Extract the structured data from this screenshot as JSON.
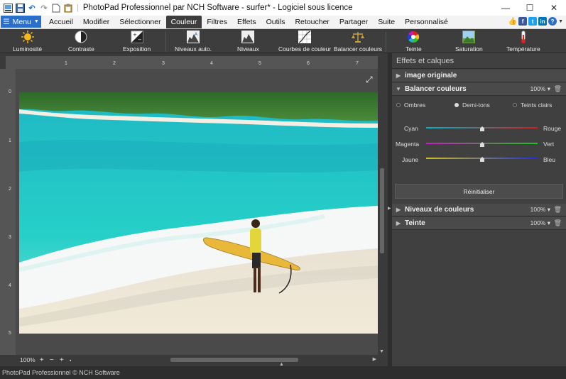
{
  "window": {
    "title": "PhotoPad Professionnel par NCH Software - surfer* - Logiciel sous licence",
    "controls": {
      "minimize": "—",
      "maximize": "☐",
      "close": "✕"
    }
  },
  "quick_access": [
    "app-icon",
    "save-icon",
    "undo-icon",
    "redo-icon",
    "new-icon",
    "paste-icon"
  ],
  "menu_button": "Menu",
  "tabs": [
    {
      "label": "Accueil",
      "active": false
    },
    {
      "label": "Modifier",
      "active": false
    },
    {
      "label": "Sélectionner",
      "active": false
    },
    {
      "label": "Couleur",
      "active": true
    },
    {
      "label": "Filtres",
      "active": false
    },
    {
      "label": "Effets",
      "active": false
    },
    {
      "label": "Outils",
      "active": false
    },
    {
      "label": "Retoucher",
      "active": false
    },
    {
      "label": "Partager",
      "active": false
    },
    {
      "label": "Suite",
      "active": false
    },
    {
      "label": "Personnalisé",
      "active": false
    }
  ],
  "social": [
    "thumbs-up-icon",
    "facebook-icon",
    "twitter-icon",
    "linkedin-icon",
    "help-icon"
  ],
  "toolbar": [
    {
      "label": "Luminosité",
      "icon": "sun-icon"
    },
    {
      "label": "Contraste",
      "icon": "contrast-icon"
    },
    {
      "label": "Exposition",
      "icon": "exposure-icon"
    },
    {
      "label": "Niveaux auto.",
      "icon": "auto-levels-icon"
    },
    {
      "label": "Niveaux",
      "icon": "levels-icon"
    },
    {
      "label": "Courbes de couleur",
      "icon": "color-curves-icon"
    },
    {
      "label": "Balancer couleurs",
      "icon": "color-balance-icon"
    },
    {
      "label": "Teinte",
      "icon": "hue-wheel-icon"
    },
    {
      "label": "Saturation",
      "icon": "saturation-icon"
    },
    {
      "label": "Température",
      "icon": "thermometer-icon"
    }
  ],
  "ruler": {
    "top": [
      "1",
      "2",
      "3",
      "4",
      "5",
      "6",
      "7"
    ],
    "left": [
      "0",
      "1",
      "2",
      "3",
      "4",
      "5"
    ]
  },
  "zoom": {
    "level": "100%",
    "minus": "−",
    "plus": "+"
  },
  "panel": {
    "title": "Effets et calques",
    "layers": [
      {
        "name": "image originale",
        "percent": ""
      },
      {
        "name": "Balancer couleurs",
        "percent": "100%"
      },
      {
        "name": "Niveaux de couleurs",
        "percent": "100%"
      },
      {
        "name": "Teinte",
        "percent": "100%"
      }
    ],
    "tones": [
      "Ombres",
      "Demi-tons",
      "Teints clairs"
    ],
    "selected_tone": "Demi-tons",
    "sliders": [
      {
        "left": "Cyan",
        "right": "Rouge",
        "value": 0,
        "colors": [
          "#00b4c8",
          "#d02020"
        ]
      },
      {
        "left": "Magenta",
        "right": "Vert",
        "value": 0,
        "colors": [
          "#c020c0",
          "#20c020"
        ]
      },
      {
        "left": "Jaune",
        "right": "Bleu",
        "value": 0,
        "colors": [
          "#d0c020",
          "#2030d0"
        ]
      }
    ],
    "reset_label": "Réinitialiser"
  },
  "status": "PhotoPad Professionnel © NCH Software"
}
